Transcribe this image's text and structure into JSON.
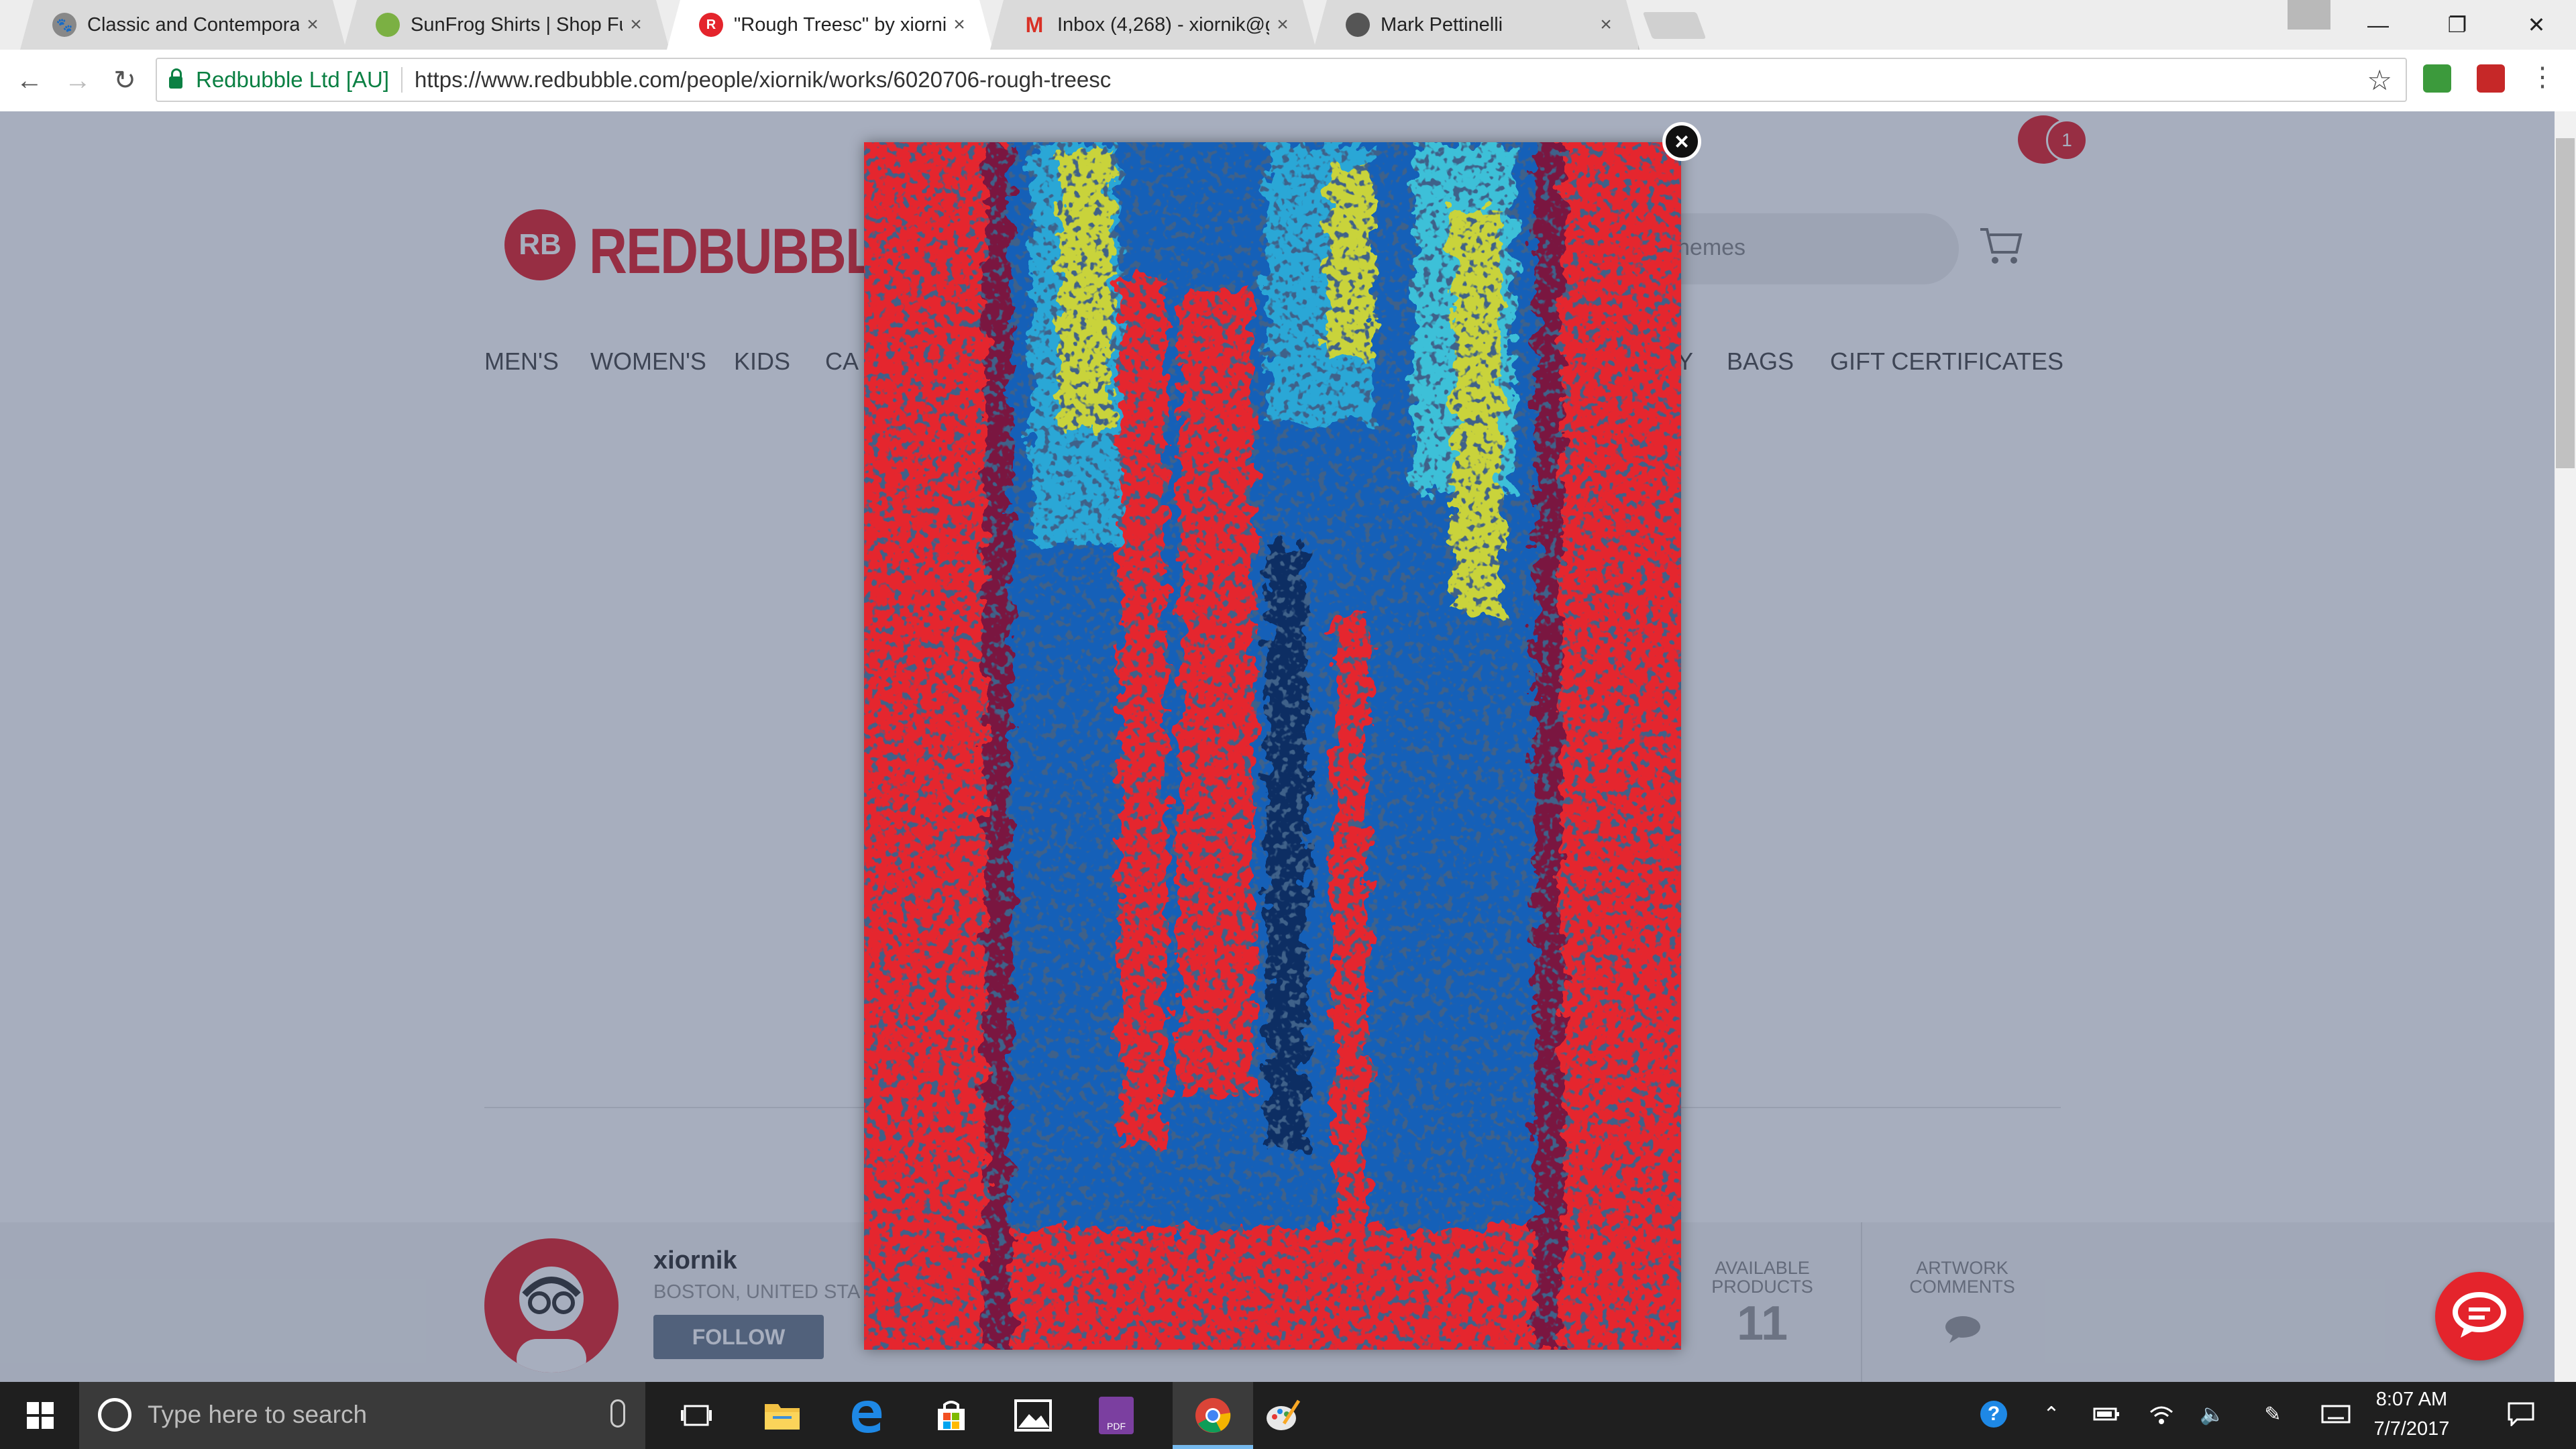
{
  "browser": {
    "tabs": [
      {
        "title": "Classic and Contempora",
        "favicon": "dog-icon",
        "active": false
      },
      {
        "title": "SunFrog Shirts | Shop Fu",
        "favicon": "sunfrog-icon",
        "active": false
      },
      {
        "title": "\"Rough Treesc\" by xiorni",
        "favicon": "redbubble-icon",
        "active": true
      },
      {
        "title": "Inbox (4,268) - xiornik@g",
        "favicon": "gmail-icon",
        "active": false
      },
      {
        "title": "Mark Pettinelli",
        "favicon": "ghost-icon",
        "active": false
      }
    ],
    "security_label": "Redbubble Ltd [AU]",
    "url": "https://www.redbubble.com/people/xiornik/works/6020706-rough-treesc"
  },
  "site": {
    "logo_mark": "RB",
    "logo_text": "REDBUBBLE",
    "search_placeholder": "hemes",
    "notification_count": "1",
    "nav": [
      "MEN'S",
      "WOMEN'S",
      "KIDS",
      "CA",
      "Y",
      "BAGS",
      "GIFT CERTIFICATES"
    ]
  },
  "profile": {
    "username": "xiornik",
    "location": "BOSTON, UNITED STA",
    "follow_label": "FOLLOW",
    "stats": [
      {
        "label_line1": "AVAILABLE",
        "label_line2": "PRODUCTS",
        "value": "11"
      },
      {
        "label_line1": "ARTWORK",
        "label_line2": "COMMENTS",
        "value": ""
      }
    ]
  },
  "lightbox": {
    "close_label": "×",
    "artwork_colors": [
      "#e5262e",
      "#1565c0",
      "#0d2f63",
      "#2aa7d6",
      "#c9d33a",
      "#7a1840"
    ]
  },
  "taskbar": {
    "search_placeholder": "Type here to search",
    "time": "8:07 AM",
    "date": "7/7/2017"
  },
  "colors": {
    "brand_red": "#e4242c",
    "overlay": "rgba(45,63,99,0.42)",
    "secure_green": "#0b8043"
  }
}
